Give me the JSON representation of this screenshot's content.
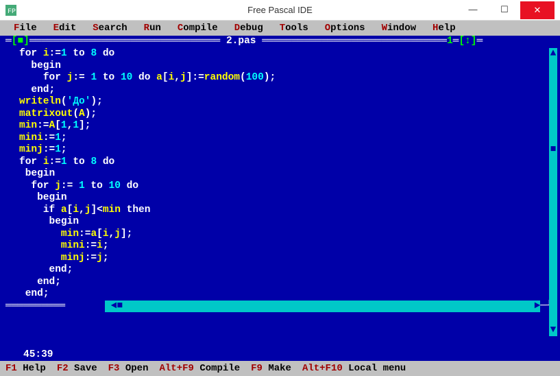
{
  "window": {
    "title": "Free Pascal IDE"
  },
  "menu": {
    "items": [
      {
        "hot": "F",
        "rest": "ile"
      },
      {
        "hot": "E",
        "rest": "dit"
      },
      {
        "hot": "S",
        "rest": "earch"
      },
      {
        "hot": "R",
        "rest": "un"
      },
      {
        "hot": "C",
        "rest": "ompile"
      },
      {
        "hot": "D",
        "rest": "ebug"
      },
      {
        "hot": "T",
        "rest": "ools"
      },
      {
        "hot": "O",
        "rest": "ptions"
      },
      {
        "hot": "W",
        "rest": "indow"
      },
      {
        "hot": "H",
        "rest": "elp"
      }
    ]
  },
  "editor": {
    "filename": "2.pas",
    "window_number": "1",
    "cursor": "45:39",
    "lines": [
      [
        [
          "kw",
          "for "
        ],
        [
          "ident",
          "i"
        ],
        [
          "sym",
          ":="
        ],
        [
          "num",
          "1"
        ],
        [
          "kw",
          " to "
        ],
        [
          "num",
          "8"
        ],
        [
          "kw",
          " do"
        ]
      ],
      [
        [
          "sp",
          "  "
        ],
        [
          "kw",
          "begin"
        ]
      ],
      [
        [
          "sp",
          "    "
        ],
        [
          "kw",
          "for "
        ],
        [
          "ident",
          "j"
        ],
        [
          "sym",
          ":= "
        ],
        [
          "num",
          "1"
        ],
        [
          "kw",
          " to "
        ],
        [
          "num",
          "10"
        ],
        [
          "kw",
          " do "
        ],
        [
          "ident",
          "a"
        ],
        [
          "sym",
          "["
        ],
        [
          "ident",
          "i"
        ],
        [
          "sym",
          ","
        ],
        [
          "ident",
          "j"
        ],
        [
          "sym",
          "]:="
        ],
        [
          "ident",
          "random"
        ],
        [
          "sym",
          "("
        ],
        [
          "num",
          "100"
        ],
        [
          "sym",
          ");"
        ]
      ],
      [
        [
          "sp",
          "  "
        ],
        [
          "kw",
          "end"
        ],
        [
          "sym",
          ";"
        ]
      ],
      [
        [
          "ident",
          "writeln"
        ],
        [
          "sym",
          "("
        ],
        [
          "str",
          "'До'"
        ],
        [
          "sym",
          ");"
        ]
      ],
      [
        [
          "ident",
          "matrixout"
        ],
        [
          "sym",
          "("
        ],
        [
          "ident",
          "A"
        ],
        [
          "sym",
          ");"
        ]
      ],
      [
        [
          "ident",
          "min"
        ],
        [
          "sym",
          ":="
        ],
        [
          "ident",
          "A"
        ],
        [
          "sym",
          "["
        ],
        [
          "num",
          "1"
        ],
        [
          "sym",
          ","
        ],
        [
          "num",
          "1"
        ],
        [
          "sym",
          "];"
        ]
      ],
      [
        [
          "ident",
          "mini"
        ],
        [
          "sym",
          ":="
        ],
        [
          "num",
          "1"
        ],
        [
          "sym",
          ";"
        ]
      ],
      [
        [
          "ident",
          "minj"
        ],
        [
          "sym",
          ":="
        ],
        [
          "num",
          "1"
        ],
        [
          "sym",
          ";"
        ]
      ],
      [
        [
          "kw",
          "for "
        ],
        [
          "ident",
          "i"
        ],
        [
          "sym",
          ":="
        ],
        [
          "num",
          "1"
        ],
        [
          "kw",
          " to "
        ],
        [
          "num",
          "8"
        ],
        [
          "kw",
          " do"
        ]
      ],
      [
        [
          "sp",
          " "
        ],
        [
          "kw",
          "begin"
        ]
      ],
      [
        [
          "sp",
          "  "
        ],
        [
          "kw",
          "for "
        ],
        [
          "ident",
          "j"
        ],
        [
          "sym",
          ":= "
        ],
        [
          "num",
          "1"
        ],
        [
          "kw",
          " to "
        ],
        [
          "num",
          "10"
        ],
        [
          "kw",
          " do"
        ]
      ],
      [
        [
          "sp",
          "   "
        ],
        [
          "kw",
          "begin"
        ]
      ],
      [
        [
          "sp",
          "    "
        ],
        [
          "kw",
          "if "
        ],
        [
          "ident",
          "a"
        ],
        [
          "sym",
          "["
        ],
        [
          "ident",
          "i"
        ],
        [
          "sym",
          ","
        ],
        [
          "ident",
          "j"
        ],
        [
          "sym",
          "]<"
        ],
        [
          "ident",
          "min"
        ],
        [
          "kw",
          " then"
        ]
      ],
      [
        [
          "sp",
          "     "
        ],
        [
          "kw",
          "begin"
        ]
      ],
      [
        [
          "sp",
          "       "
        ],
        [
          "ident",
          "min"
        ],
        [
          "sym",
          ":="
        ],
        [
          "ident",
          "a"
        ],
        [
          "sym",
          "["
        ],
        [
          "ident",
          "i"
        ],
        [
          "sym",
          ","
        ],
        [
          "ident",
          "j"
        ],
        [
          "sym",
          "];"
        ]
      ],
      [
        [
          "sp",
          "       "
        ],
        [
          "ident",
          "mini"
        ],
        [
          "sym",
          ":="
        ],
        [
          "ident",
          "i"
        ],
        [
          "sym",
          ";"
        ]
      ],
      [
        [
          "sp",
          "       "
        ],
        [
          "ident",
          "minj"
        ],
        [
          "sym",
          ":="
        ],
        [
          "ident",
          "j"
        ],
        [
          "sym",
          ";"
        ]
      ],
      [
        [
          "sp",
          "     "
        ],
        [
          "kw",
          "end"
        ],
        [
          "sym",
          ";"
        ]
      ],
      [
        [
          "sp",
          "   "
        ],
        [
          "kw",
          "end"
        ],
        [
          "sym",
          ";"
        ]
      ],
      [
        [
          "sp",
          " "
        ],
        [
          "kw",
          "end"
        ],
        [
          "sym",
          ";"
        ]
      ]
    ]
  },
  "status": {
    "items": [
      {
        "key": "F1",
        "label": "Help"
      },
      {
        "key": "F2",
        "label": "Save"
      },
      {
        "key": "F3",
        "label": "Open"
      },
      {
        "key": "Alt+F9",
        "label": "Compile"
      },
      {
        "key": "F9",
        "label": "Make"
      },
      {
        "key": "Alt+F10",
        "label": "Local menu"
      }
    ]
  }
}
